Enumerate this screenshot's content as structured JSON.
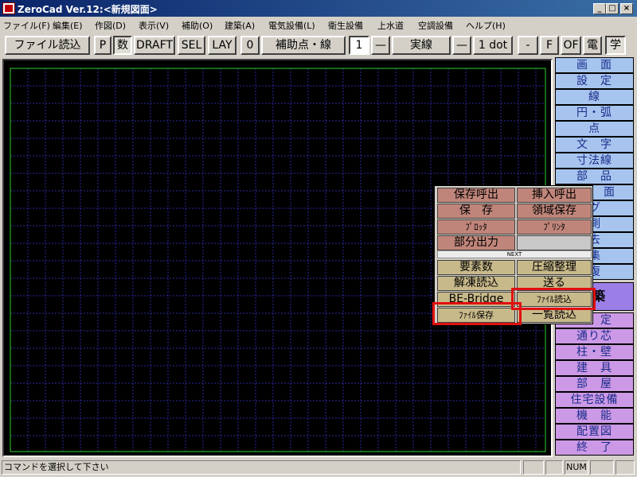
{
  "window": {
    "title": "ZeroCad Ver.12:<新規図面>",
    "minimize": "_",
    "maximize": "□",
    "close": "×"
  },
  "menu": [
    "ファイル(F)",
    "編集(E)",
    "作図(D)",
    "表示(V)",
    "補助(O)",
    "建築(A)",
    "電気設備(L)",
    "衛生設備",
    "上水道",
    "空調設備",
    "ヘルプ(H)"
  ],
  "toolbar": {
    "file_read": "ファイル読込",
    "p": "P",
    "kazu": "数",
    "draft": "DRAFT",
    "sel": "SEL",
    "lay": "LAY",
    "zero": "0",
    "aux_line": "補助点・線",
    "layer_num": "1",
    "line_sample": "—",
    "line_type": "実線",
    "dash": "—",
    "dot_width": "1 dot",
    "minus": "-",
    "f": "F",
    "of": "OF",
    "den": "電",
    "gaku": "学"
  },
  "sidepanel": {
    "top": [
      "画　面",
      "設　定",
      "線",
      "円・弧",
      "点",
      "文　字",
      "寸法線",
      "部　品"
    ],
    "partial": [
      "面",
      "ング",
      "測",
      "去",
      "集",
      "復"
    ],
    "big": "築",
    "bottom_partial": "設　定",
    "bottom": [
      "通り芯",
      "柱・壁",
      "建　具",
      "部　屋",
      "住宅設備",
      "機　能",
      "配置図",
      "終　了"
    ]
  },
  "popup": {
    "row1": [
      "保存呼出",
      "挿入呼出"
    ],
    "row2": [
      "保　存",
      "領域保存"
    ],
    "row3": [
      "ﾌﾟﾛｯﾀ",
      "ﾌﾟﾘﾝﾀ"
    ],
    "row4": [
      "部分出力"
    ],
    "next": "NEXT",
    "row5": [
      "要素数",
      "圧縮整理"
    ],
    "row6": [
      "解凍読込",
      "送る"
    ],
    "row7": [
      "BE-Bridge",
      "ﾌｧｲﾙ読込"
    ],
    "row8": [
      "ﾌｧｲﾙ保存",
      "一覧読込"
    ]
  },
  "status": {
    "message": "コマンドを選択して下さい",
    "num": "NUM"
  },
  "colors": {
    "canvas_bg": "#000000",
    "grid": "#2a2aa0",
    "frame": "#30d030",
    "highlight": "#e01010"
  }
}
